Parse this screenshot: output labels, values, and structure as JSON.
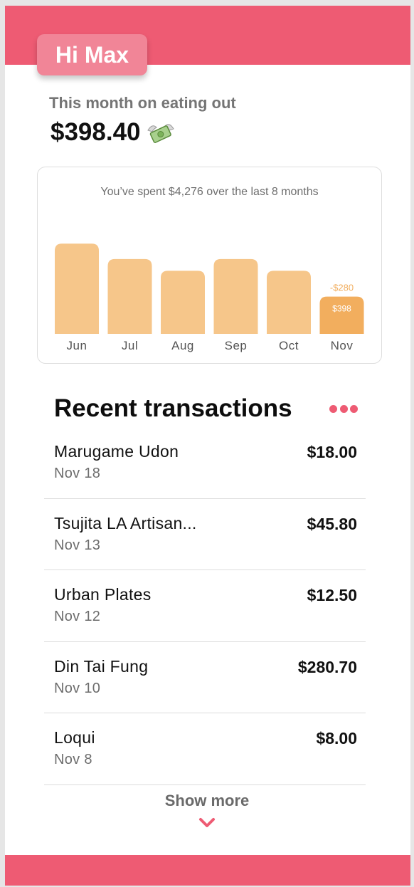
{
  "header": {
    "greeting": "Hi Max"
  },
  "summary": {
    "label": "This month on eating out",
    "amount": "$398.40",
    "icon": "money-with-wings-icon"
  },
  "chart_data": {
    "type": "bar",
    "title": "You’ve spent $4,276 over the last 8 months",
    "categories": [
      "Jun",
      "Jul",
      "Aug",
      "Sep",
      "Oct",
      "Nov"
    ],
    "values": [
      678,
      562,
      474,
      562,
      474,
      280
    ],
    "current_label": "$398",
    "delta_label": "-$280",
    "colors": {
      "bar": "#f6c68a",
      "current": "#f2ae5e",
      "delta": "#f2ae5e",
      "label": "#555555"
    }
  },
  "transactions": {
    "title": "Recent transactions",
    "items": [
      {
        "name": "Marugame Udon",
        "date": "Nov 18",
        "amount": "$18.00"
      },
      {
        "name": "Tsujita LA Artisan...",
        "date": "Nov 13",
        "amount": "$45.80"
      },
      {
        "name": "Urban Plates",
        "date": "Nov 12",
        "amount": "$12.50"
      },
      {
        "name": "Din Tai Fung",
        "date": "Nov 10",
        "amount": "$280.70"
      },
      {
        "name": "Loqui",
        "date": "Nov 8",
        "amount": "$8.00"
      }
    ],
    "show_more": "Show more"
  },
  "colors": {
    "accent": "#ee5b73",
    "greeting_bg": "#f18597"
  }
}
